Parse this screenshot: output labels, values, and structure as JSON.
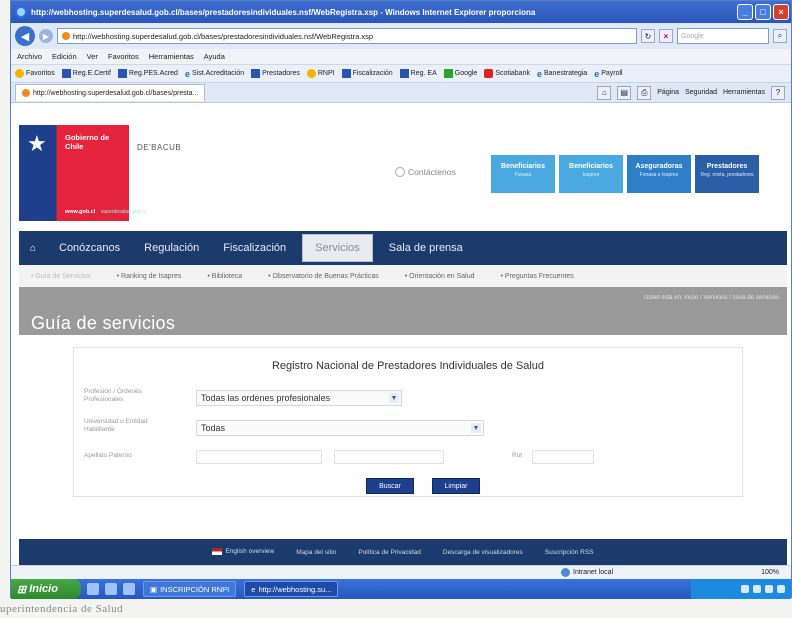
{
  "window": {
    "title": "http://webhosting.superdesalud.gob.cl/bases/prestadoresindividuales.nsf/WebRegistra.xsp - Windows Internet Explorer proporciona"
  },
  "address_bar": {
    "url": "http://webhosting.superdesalud.gob.cl/bases/prestadoresindividuales.nsf/WebRegistra.xsp",
    "search_placeholder": "Google"
  },
  "menu": [
    "Archivo",
    "Edición",
    "Ver",
    "Favoritos",
    "Herramientas",
    "Ayuda"
  ],
  "favorites": {
    "label": "Favoritos",
    "items": [
      "Reg.E.Certif",
      "Reg.PES.Acred",
      "Sist.Acreditación",
      "Prestadores",
      "RNPI",
      "Fiscalización",
      "Reg. EA",
      "Google",
      "Scotiabank",
      "Banestrategia",
      "Payroll"
    ]
  },
  "tab": {
    "label": "http://webhosting.superdesalud.gob.cl/bases/presta..."
  },
  "command_bar": [
    "Página",
    "Seguridad",
    "Herramientas"
  ],
  "header": {
    "gob_label": "Gobierno de Chile",
    "gob_url": "www.gob.cl",
    "sigla": "DE'BACUB",
    "contact": "Contáctenos",
    "quick_buttons": [
      {
        "label": "Beneficiarios",
        "sub": "Fonasa",
        "color": "#4aa9e0"
      },
      {
        "label": "Beneficiarios",
        "sub": "Isapres",
        "color": "#4aa9e0"
      },
      {
        "label": "Aseguradoras",
        "sub": "Fonasa e Isapres",
        "color": "#2f7fc8"
      },
      {
        "label": "Prestadores",
        "sub": "Reg. mixta, prestadores",
        "color": "#2a5fa8"
      }
    ]
  },
  "main_nav": [
    "Conózcanos",
    "Regulación",
    "Fiscalización",
    "Servicios",
    "Sala de prensa"
  ],
  "main_nav_active": "Servicios",
  "sub_nav": [
    "• Guía de Servicios",
    "• Ranking de Isapres",
    "• Biblioteca",
    "• Observatorio de Buenas Prácticas",
    "• Orientación en Salud",
    "• Preguntas Frecuentes"
  ],
  "banner": {
    "title": "Guía de servicios",
    "breadcrumb": "Usted está en: Inicio / Servicios / Guía de servicios"
  },
  "form": {
    "title": "Registro Nacional de Prestadores Individuales de Salud",
    "profesion_label": "Profesión / Órdenes Profesionales",
    "profesion_value": "Todas las ordenes profesionales",
    "universidad_label": "Universidad o Entidad Habilitante",
    "universidad_value": "Todas",
    "apellido_label": "Apellido Paterno",
    "rut_label": "Rut",
    "buscar_label": "Buscar",
    "limpiar_label": "Limpiar"
  },
  "footer": [
    "English overview",
    "Mapa del sitio",
    "Política de Privacidad",
    "Descarga de visualizadores",
    "Suscripción RSS"
  ],
  "status": {
    "zone": "Intranet local",
    "zoom": "100%"
  },
  "taskbar": {
    "start": "Inicio",
    "tasks": [
      "INSCRIPCIÓN RNPI",
      "http://webhosting.su..."
    ]
  },
  "below_text": "uperintendencia de Salud"
}
